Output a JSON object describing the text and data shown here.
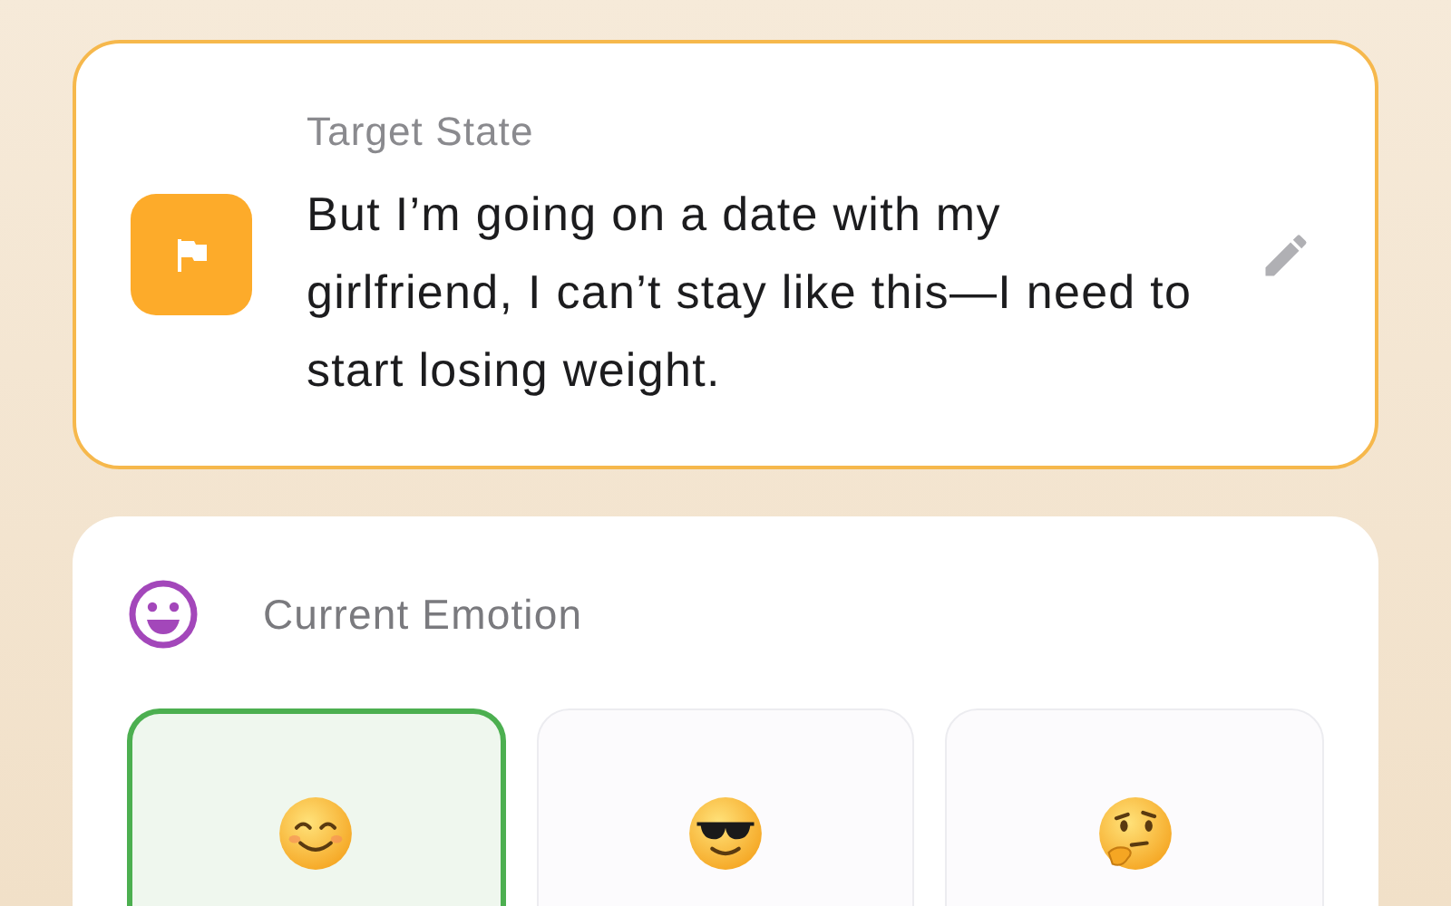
{
  "target": {
    "label": "Target State",
    "text": "But I’m going on a date with my girlfriend, I can’t stay like this—I need to start losing weight."
  },
  "emotion": {
    "label": "Current Emotion",
    "options": [
      {
        "kind": "smiling",
        "selected": true
      },
      {
        "kind": "sunglasses",
        "selected": false
      },
      {
        "kind": "thinking",
        "selected": false
      }
    ]
  }
}
